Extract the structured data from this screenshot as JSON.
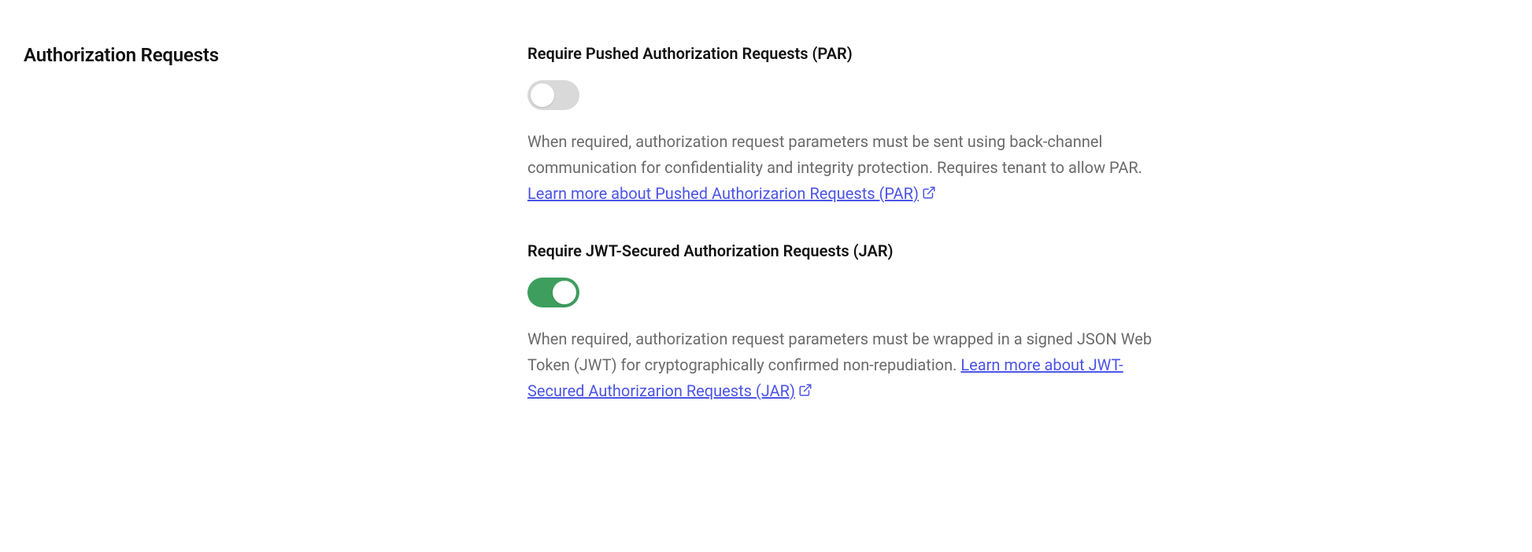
{
  "section": {
    "title": "Authorization Requests"
  },
  "settings": {
    "par": {
      "label": "Require Pushed Authorization Requests (PAR)",
      "enabled": false,
      "description": "When required, authorization request parameters must be sent using back-channel communication for confidentiality and integrity protection. Requires tenant to allow PAR. ",
      "link_text": "Learn more about Pushed Authorizarion Requests (PAR)"
    },
    "jar": {
      "label": "Require JWT-Secured Authorization Requests (JAR)",
      "enabled": true,
      "description": "When required, authorization request parameters must be wrapped in a signed JSON Web Token (JWT) for cryptographically confirmed non-repudiation. ",
      "link_text": "Learn more about JWT-Secured Authorizarion Requests (JAR)"
    }
  }
}
